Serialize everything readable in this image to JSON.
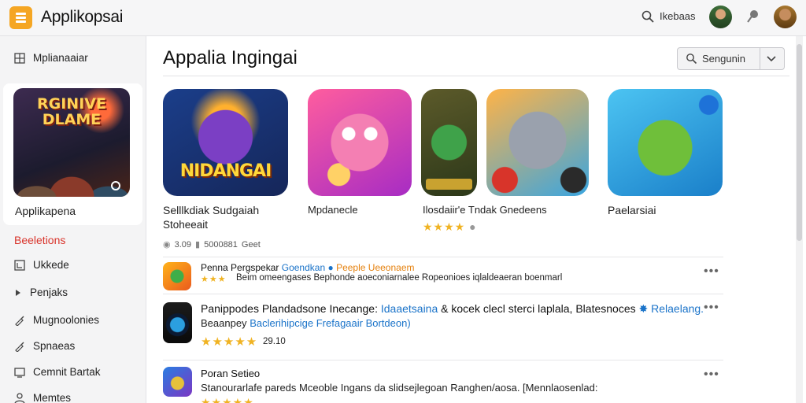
{
  "app": {
    "title": "Applikopsai",
    "brand_color": "#f5a623"
  },
  "header": {
    "search_label": "Ikebaas",
    "search_icon": "search-icon",
    "pin_icon": "pin-icon"
  },
  "sidebar": {
    "top_item": {
      "label": "Mplianaaiar",
      "icon": "grid-icon"
    },
    "card": {
      "label": "Applikapena",
      "image_text": "RGINIVE\nDLAME"
    },
    "section_label": "Beeletions",
    "section_color": "#d9342b",
    "items": [
      {
        "label": "Ukkede",
        "icon": "box-icon"
      },
      {
        "label": "Penjaks",
        "icon": "chevron-right-icon"
      },
      {
        "label": "Mugnoolonies",
        "icon": "paint-brush-icon"
      },
      {
        "label": "Spnaeas",
        "icon": "paint-brush-icon"
      },
      {
        "label": "Cemnit Bartak",
        "icon": "monitor-icon"
      },
      {
        "label": "Memtes",
        "icon": "person-icon"
      }
    ]
  },
  "main": {
    "title": "Appalia Ingingai",
    "sort_label": "Sengunin",
    "featured": [
      {
        "label": "Selllkdiak Sudgaiah",
        "sublabel": "Stoheeait",
        "image_text": "NIDANGAI"
      },
      {
        "label": "Mpdanecle"
      },
      {
        "label": "Ilosdaiir'e Tndak Gnedeens",
        "rating": 4
      },
      {
        "label": "Paelarsiai"
      }
    ],
    "meta": {
      "item1": "3.09",
      "item2": "5000881",
      "item3": "Geet"
    },
    "list": [
      {
        "title_prefix": "Penna Pergspekar",
        "title_accent": "Goendkan",
        "title_accent2": "Peeple Ueeonaem",
        "description": "Beim omeengases Bephonde aoeconiarnalee Ropeonioes iqlaldeaeran boenmarl",
        "rating": 3
      },
      {
        "title": "Panippodes Plandadsone Inecange:",
        "title_accent": "Idaaetsaina",
        "title_rest": "& kocek clecl sterci laplala, Blatesnoces",
        "title_accent2": "Relaelang.",
        "description_prefix": "Beaanpey",
        "description_accent": "Baclerihipcige Frefagaair Bortdeon)",
        "rating": 5,
        "rating_value": "29.10"
      },
      {
        "title": "Poran Setieo",
        "description": "Stanourarlafe pareds Mceoble Ingans da slidsejlegoan Ranghen/aosa. [Mennlaosenlad:",
        "rating": 5
      }
    ]
  }
}
